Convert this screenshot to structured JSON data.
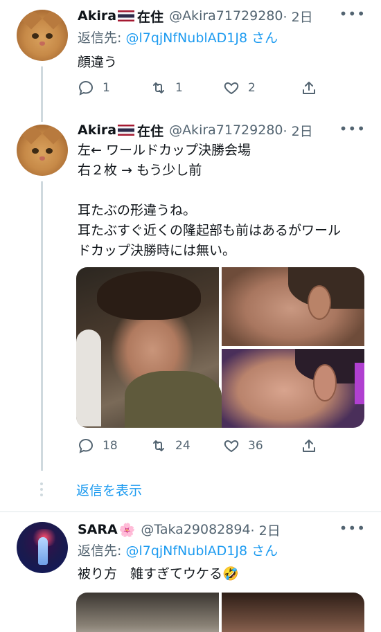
{
  "tweet1": {
    "name": "Akira",
    "name_suffix": "在住",
    "handle": "@Akira71729280",
    "time": "· 2日",
    "reply_label": "返信先: ",
    "reply_to": "@l7qjNfNublAD1J8",
    "reply_suffix": " さん",
    "text": "顔違う",
    "replies": "1",
    "retweets": "1",
    "likes": "2"
  },
  "tweet2": {
    "name": "Akira",
    "name_suffix": "在住",
    "handle": "@Akira71729280",
    "time": "· 2日",
    "text": "左← ワールドカップ決勝会場\n右２枚 → もう少し前\n\n耳たぶの形違うね。\n耳たぶすぐ近くの隆起部も前はあるがワール\nドカップ決勝時には無い。",
    "replies": "18",
    "retweets": "24",
    "likes": "36"
  },
  "show_replies": "返信を表示",
  "tweet3": {
    "name": "SARA",
    "name_emoji": "🌸",
    "handle": "@Taka29082894",
    "time": "· 2日",
    "reply_label": "返信先: ",
    "reply_to": "@l7qjNfNublAD1J8",
    "reply_suffix": " さん",
    "text": "被り方　雑すぎてウケる🤣"
  },
  "more_icon": "•••",
  "colors": {
    "link": "#1d9bf0",
    "muted": "#536471",
    "text": "#0f1419"
  }
}
